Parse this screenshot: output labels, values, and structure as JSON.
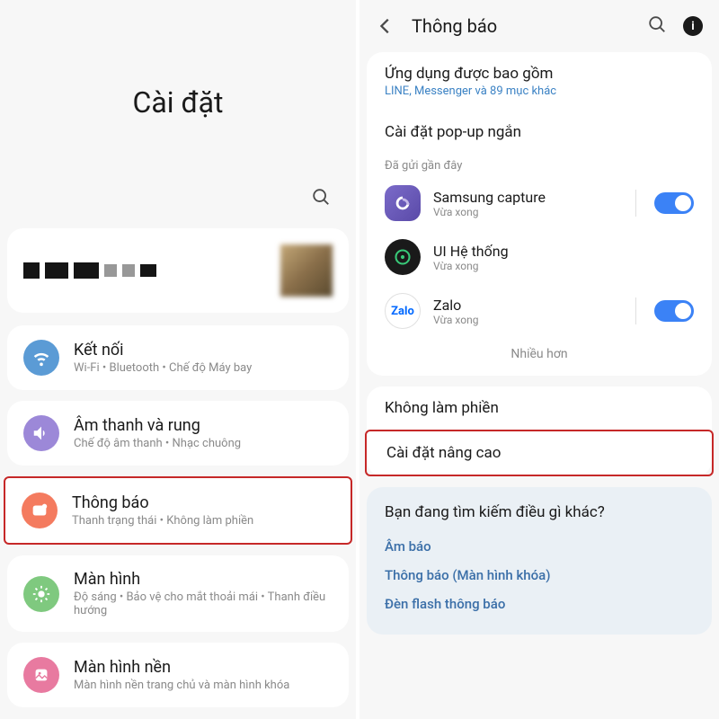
{
  "left": {
    "title": "Cài đặt",
    "items": [
      {
        "title": "Kết nối",
        "sub": "Wi-Fi • Bluetooth • Chế độ Máy bay"
      },
      {
        "title": "Âm thanh và rung",
        "sub": "Chế độ âm thanh • Nhạc chuông"
      },
      {
        "title": "Thông báo",
        "sub": "Thanh trạng thái • Không làm phiền"
      },
      {
        "title": "Màn hình",
        "sub": "Độ sáng • Bảo vệ cho mắt thoải mái • Thanh điều hướng"
      },
      {
        "title": "Màn hình nền",
        "sub": "Màn hình nền trang chủ và màn hình khóa"
      }
    ]
  },
  "right": {
    "nav_title": "Thông báo",
    "included": {
      "title": "Ứng dụng được bao gồm",
      "sub": "LINE, Messenger và 89 mục khác"
    },
    "popup": "Cài đặt pop-up ngắn",
    "recent_label": "Đã gửi gần đây",
    "apps": [
      {
        "title": "Samsung capture",
        "sub": "Vừa xong",
        "toggle": true,
        "icon": "samsung"
      },
      {
        "title": "UI Hệ thống",
        "sub": "Vừa xong",
        "toggle": false,
        "icon": "system"
      },
      {
        "title": "Zalo",
        "sub": "Vừa xong",
        "toggle": true,
        "icon": "zalo",
        "zalo_text": "Zalo"
      }
    ],
    "more": "Nhiều hơn",
    "dnd": "Không làm phiền",
    "advanced": "Cài đặt nâng cao",
    "suggest": {
      "title": "Bạn đang tìm kiếm điều gì khác?",
      "links": [
        "Âm báo",
        "Thông báo (Màn hình khóa)",
        "Đèn flash thông báo"
      ]
    }
  }
}
